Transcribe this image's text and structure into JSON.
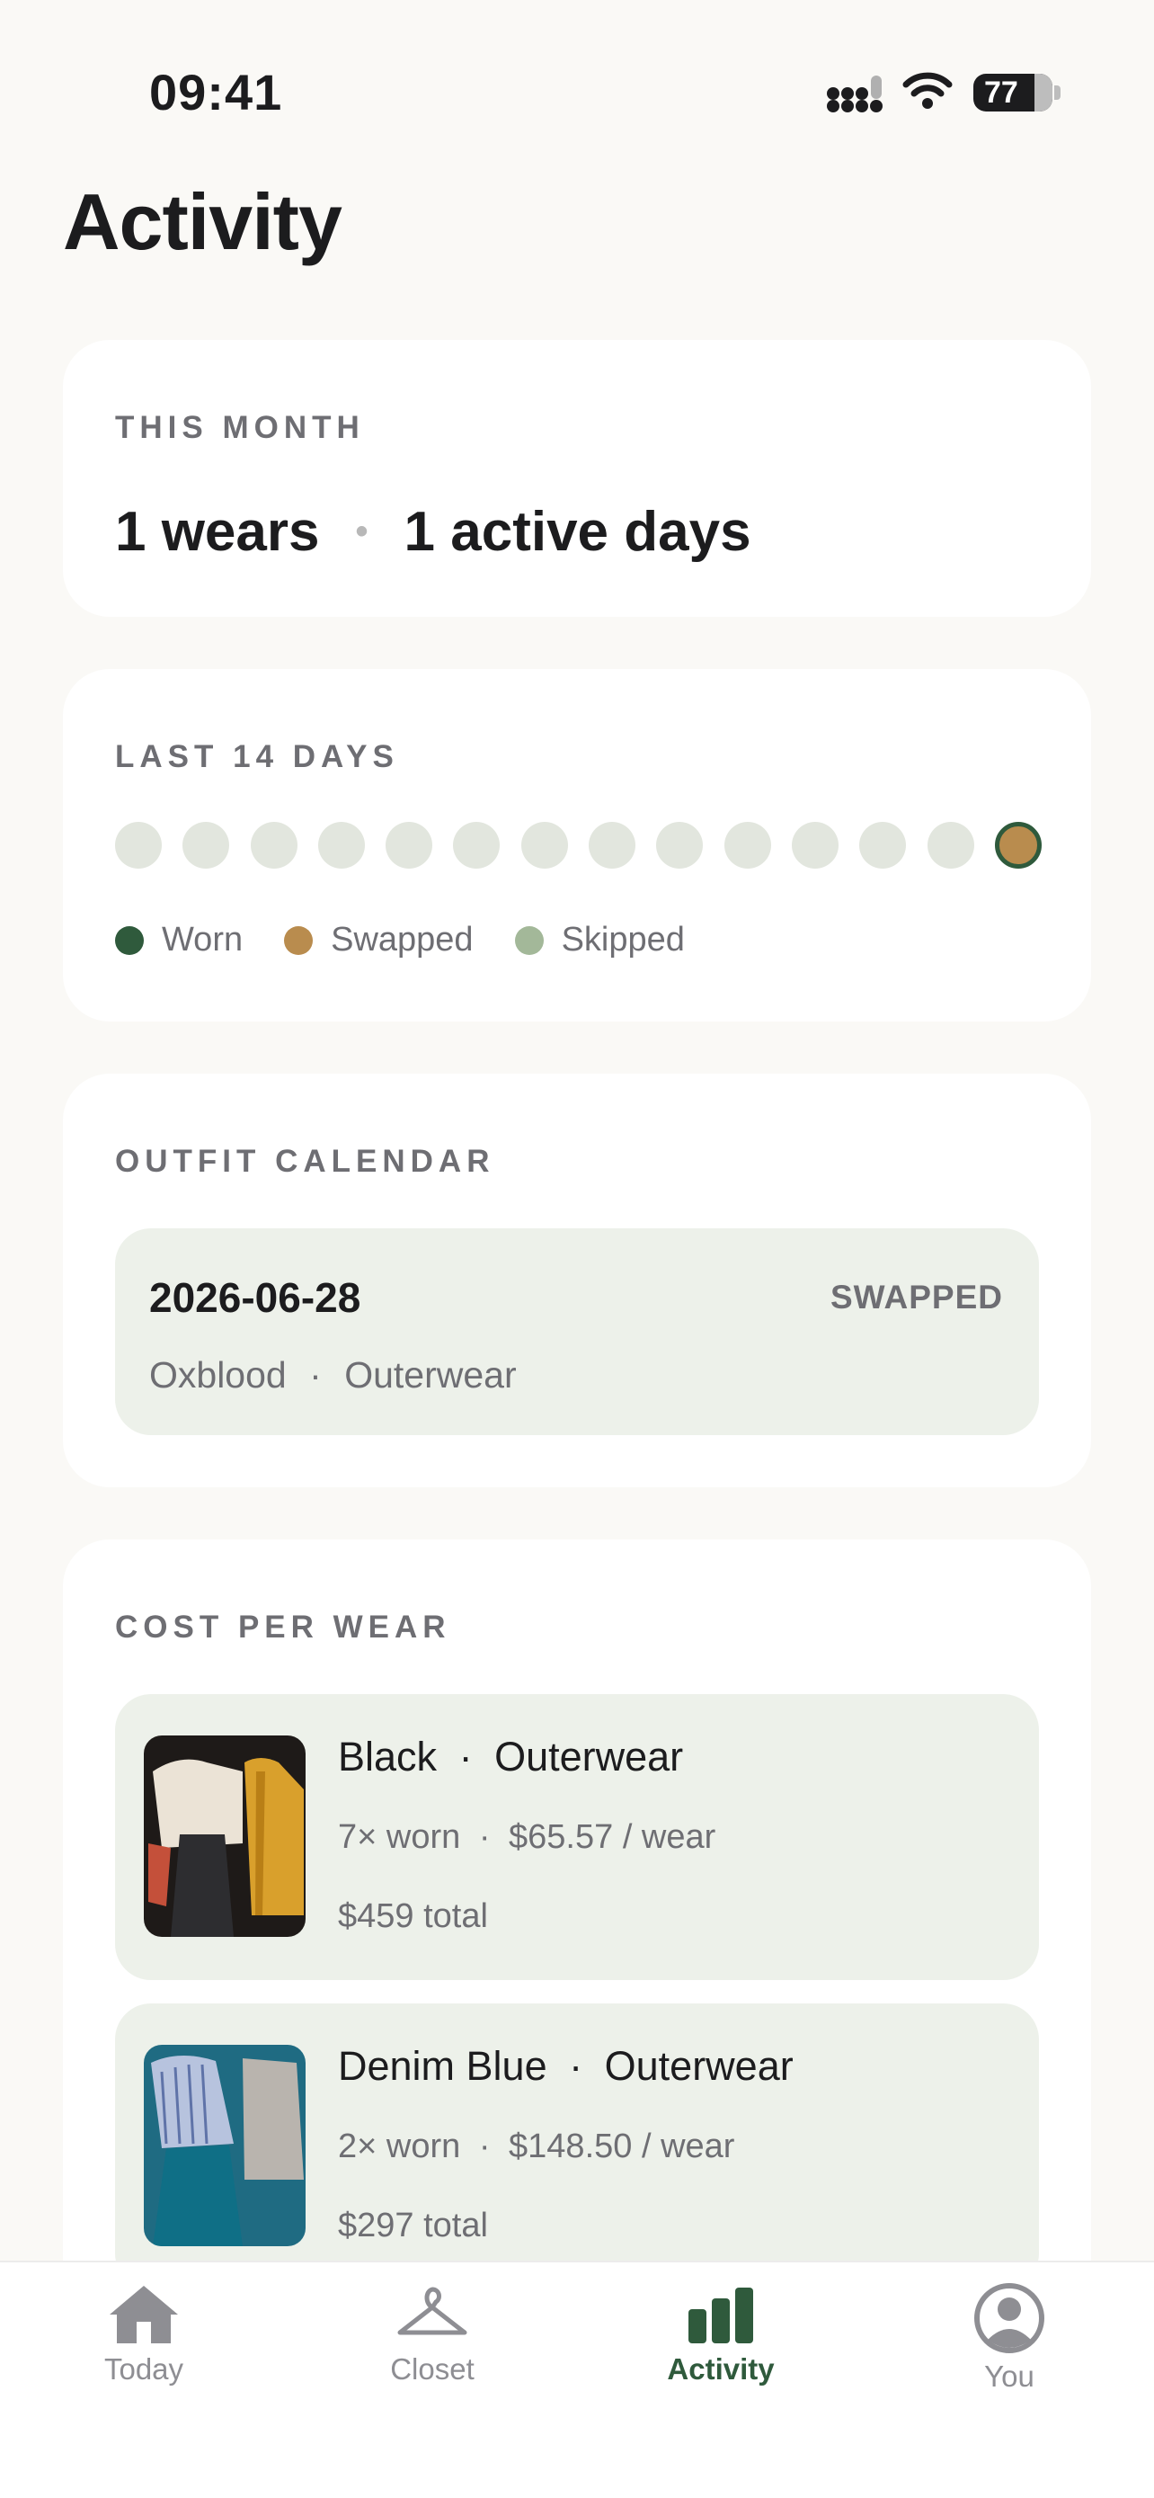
{
  "status_bar": {
    "time": "09:41",
    "battery": "77"
  },
  "page_title": "Activity",
  "this_month": {
    "label": "THIS MONTH",
    "wears": "1 wears",
    "active_days": "1 active days"
  },
  "last_14_days": {
    "label": "LAST 14 DAYS",
    "days": [
      "none",
      "none",
      "none",
      "none",
      "none",
      "none",
      "none",
      "none",
      "none",
      "none",
      "none",
      "none",
      "none",
      "swapped"
    ],
    "legend": [
      {
        "label": "Worn",
        "color": "#2f5a3c"
      },
      {
        "label": "Swapped",
        "color": "#b98c4e"
      },
      {
        "label": "Skipped",
        "color": "#a3b899"
      }
    ]
  },
  "outfit_calendar": {
    "label": "OUTFIT CALENDAR",
    "entries": [
      {
        "date": "2026-06-28",
        "status": "SWAPPED",
        "color": "Oxblood",
        "category": "Outerwear"
      }
    ]
  },
  "cost_per_wear": {
    "label": "COST PER WEAR",
    "items": [
      {
        "color": "Black",
        "category": "Outerwear",
        "worn": "7× worn",
        "per_wear": "$65.57 / wear",
        "total": "$459 total"
      },
      {
        "color": "Denim Blue",
        "category": "Outerwear",
        "worn": "2× worn",
        "per_wear": "$148.50 / wear",
        "total": "$297 total"
      }
    ]
  },
  "tab_bar": {
    "tabs": [
      {
        "label": "Today",
        "icon": "house-icon"
      },
      {
        "label": "Closet",
        "icon": "hanger-icon"
      },
      {
        "label": "Activity",
        "icon": "bar-chart-icon",
        "active": true
      },
      {
        "label": "You",
        "icon": "person-circle-icon"
      }
    ]
  },
  "colors": {
    "accent": "#2f5a3c",
    "card_tint": "#edf1ea",
    "swapped": "#b98c4e"
  }
}
